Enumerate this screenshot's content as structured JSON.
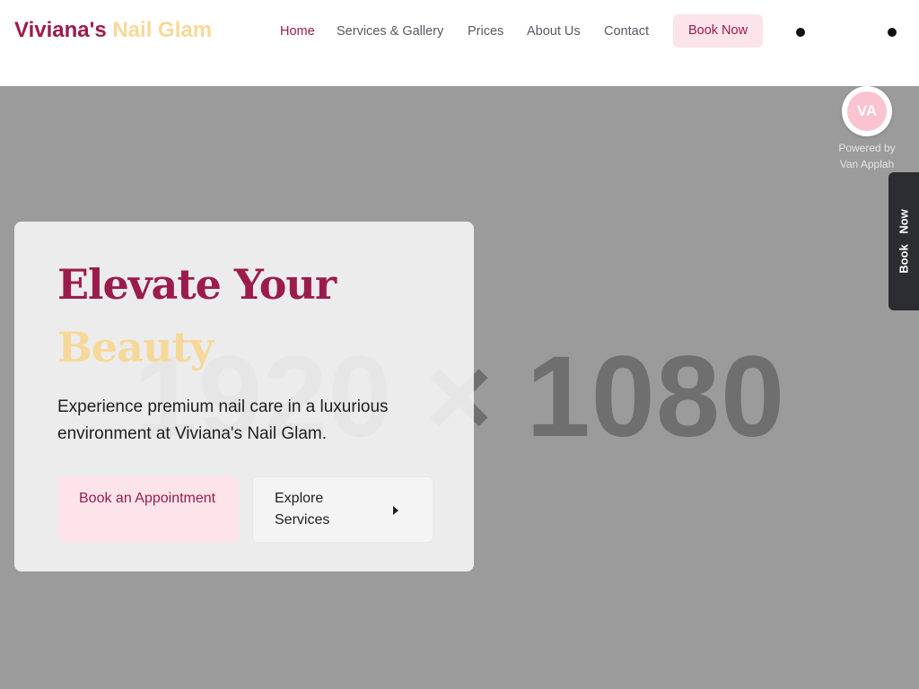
{
  "header": {
    "logo_part1": "Viviana's",
    "logo_part2": "Nail Glam",
    "nav": [
      {
        "label": "Home",
        "active": true
      },
      {
        "label": "Services & Gallery",
        "active": false
      },
      {
        "label": "Prices",
        "active": false
      },
      {
        "label": "About Us",
        "active": false
      },
      {
        "label": "Contact",
        "active": false
      }
    ],
    "book_now_label": "Book Now"
  },
  "hero": {
    "placeholder_text": "1920 × 1080",
    "title_line1": "Elevate Your",
    "title_line2": "Beauty",
    "description": "Experience premium nail care in a luxurious environment at Viviana's Nail Glam.",
    "cta_primary": "Book an Appointment",
    "cta_secondary": "Explore Services"
  },
  "badge": {
    "initials": "VA",
    "powered_line1": "Powered by",
    "powered_line2": "Van Applah"
  },
  "side_tab": {
    "label": "Book Now"
  },
  "colors": {
    "brand": "#9b1c4c",
    "accent_gold": "#f6d99a",
    "pink_button": "#fce4ea",
    "hero_bg": "#9b9b9b"
  },
  "icons": {
    "cta_secondary": "caret-right-icon"
  }
}
